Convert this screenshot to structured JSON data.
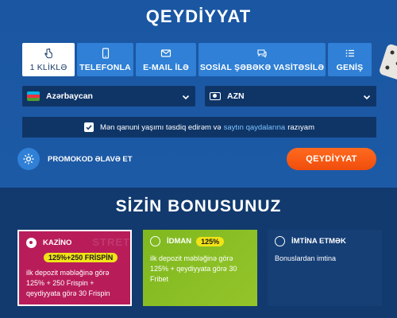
{
  "header": {
    "title": "QEYDİYYAT"
  },
  "tabs": [
    {
      "label": "1 KLİKLƏ",
      "icon": "tap-icon",
      "active": true
    },
    {
      "label": "TELEFONLA",
      "icon": "phone-icon",
      "active": false
    },
    {
      "label": "E-MAIL İLƏ",
      "icon": "mail-icon",
      "active": false
    },
    {
      "label": "SOSİAL ŞƏBƏKƏ VASİTƏSİLƏ",
      "icon": "chat-icon",
      "active": false
    },
    {
      "label": "GENİŞ",
      "icon": "list-icon",
      "active": false
    }
  ],
  "form": {
    "country": "Azərbaycan",
    "currency": "AZN",
    "agree": {
      "text_before": "Mən qanuni yaşımı təsdiq edirəm və",
      "link": "saytın qaydalarına",
      "text_after": "razıyam",
      "checked": true
    },
    "promo_label": "PROMOKOD ƏLAVƏ ET",
    "submit_label": "QEYDİYYAT"
  },
  "bonus": {
    "title": "SİZİN BONUSUNUZ",
    "cards": [
      {
        "name": "KAZİNO",
        "badge": "125%+250 FRİSPİN",
        "desc": "ilk depozit məbləğinə görə 125% + 250 Frispin + qeydiyyata görə 30 Frispin",
        "selected": true,
        "watermark": "STRET"
      },
      {
        "name": "İDMAN",
        "badge": "125%",
        "desc": "ilk depozit məbləğinə görə 125% + qeydiyyata görə 30 Fribet",
        "selected": false
      },
      {
        "name": "İMTİNA ETMƏK",
        "desc": "Bonuslardan imtina",
        "selected": false
      }
    ]
  },
  "colors": {
    "header_bg": "#1a56a2",
    "tab_bg": "#2f80d6",
    "accent_orange": "#f04d0c",
    "casino_card": "#b81d5a",
    "sport_card": "#8fc026",
    "badge_yellow": "#f1e317"
  }
}
